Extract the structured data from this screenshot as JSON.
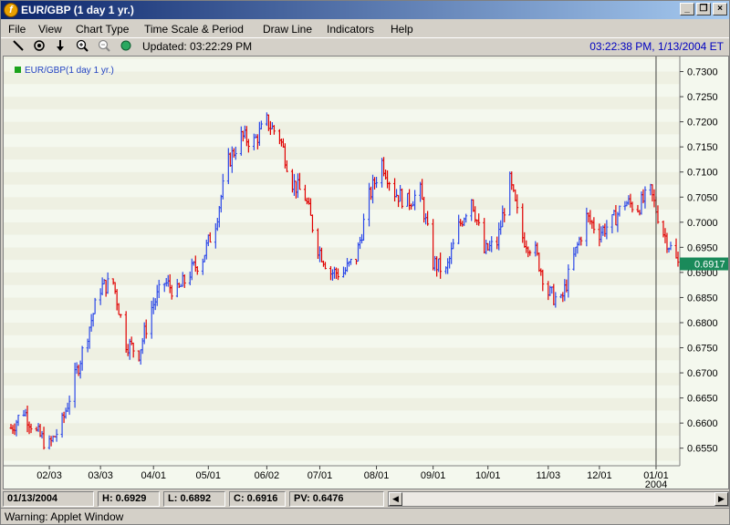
{
  "window": {
    "title": "EUR/GBP (1 day  1 yr.)",
    "minimize": "_",
    "restore": "❐",
    "close": "×"
  },
  "menu": [
    "File",
    "View",
    "Chart Type",
    "Time Scale & Period",
    "Draw Line",
    "Indicators",
    "Help"
  ],
  "toolbar": {
    "updated": "Updated: 03:22:29 PM",
    "clock": "03:22:38 PM, 1/13/2004 ET"
  },
  "status": {
    "date": "01/13/2004",
    "high": "H: 0.6929",
    "low": "L: 0.6892",
    "close": "C: 0.6916",
    "pv": "PV: 0.6476"
  },
  "warning": "Warning: Applet Window",
  "colors": {
    "up": "#2c48e8",
    "down": "#e00000",
    "current": "#1a8a5a",
    "band_a": "#eef0e2",
    "band_b": "#f4f8ee"
  },
  "chart_data": {
    "type": "ohlc",
    "legend": "EUR/GBP(1 day  1 yr.)",
    "ylim": [
      0.6515,
      0.733
    ],
    "y_ticks": [
      "0.7300",
      "0.7250",
      "0.7200",
      "0.7150",
      "0.7100",
      "0.7050",
      "0.7000",
      "0.6950",
      "0.6900",
      "0.6850",
      "0.6800",
      "0.6750",
      "0.6700",
      "0.6650",
      "0.6600",
      "0.6550"
    ],
    "x_ticks": [
      "02/03",
      "03/03",
      "04/01",
      "05/01",
      "06/02",
      "07/01",
      "08/01",
      "09/01",
      "10/01",
      "11/03",
      "12/01",
      "01/01"
    ],
    "x_sublabel": "2004",
    "current_value": "0.6917",
    "grid": false,
    "legend_position": "top-left",
    "close_anchors": [
      [
        "2003-01-13",
        0.659
      ],
      [
        "2003-01-20",
        0.6625
      ],
      [
        "2003-01-27",
        0.658
      ],
      [
        "2003-02-03",
        0.6555
      ],
      [
        "2003-02-10",
        0.66
      ],
      [
        "2003-02-17",
        0.669
      ],
      [
        "2003-02-24",
        0.678
      ],
      [
        "2003-03-03",
        0.687
      ],
      [
        "2003-03-10",
        0.688
      ],
      [
        "2003-03-17",
        0.676
      ],
      [
        "2003-03-24",
        0.674
      ],
      [
        "2003-03-31",
        0.683
      ],
      [
        "2003-04-07",
        0.688
      ],
      [
        "2003-04-14",
        0.686
      ],
      [
        "2003-04-21",
        0.69
      ],
      [
        "2003-04-28",
        0.693
      ],
      [
        "2003-05-05",
        0.7
      ],
      [
        "2003-05-12",
        0.712
      ],
      [
        "2003-05-19",
        0.717
      ],
      [
        "2003-05-26",
        0.716
      ],
      [
        "2003-06-02",
        0.72
      ],
      [
        "2003-06-09",
        0.717
      ],
      [
        "2003-06-16",
        0.708
      ],
      [
        "2003-06-23",
        0.705
      ],
      [
        "2003-06-30",
        0.695
      ],
      [
        "2003-07-07",
        0.69
      ],
      [
        "2003-07-14",
        0.69
      ],
      [
        "2003-07-21",
        0.693
      ],
      [
        "2003-07-28",
        0.705
      ],
      [
        "2003-08-04",
        0.712
      ],
      [
        "2003-08-11",
        0.706
      ],
      [
        "2003-08-18",
        0.704
      ],
      [
        "2003-08-25",
        0.706
      ],
      [
        "2003-09-01",
        0.692
      ],
      [
        "2003-09-08",
        0.69
      ],
      [
        "2003-09-15",
        0.699
      ],
      [
        "2003-09-22",
        0.705
      ],
      [
        "2003-09-29",
        0.694
      ],
      [
        "2003-10-06",
        0.696
      ],
      [
        "2003-10-13",
        0.708
      ],
      [
        "2003-10-20",
        0.697
      ],
      [
        "2003-10-27",
        0.694
      ],
      [
        "2003-11-03",
        0.686
      ],
      [
        "2003-11-10",
        0.684
      ],
      [
        "2003-11-17",
        0.693
      ],
      [
        "2003-11-24",
        0.701
      ],
      [
        "2003-12-01",
        0.698
      ],
      [
        "2003-12-08",
        0.7
      ],
      [
        "2003-12-15",
        0.704
      ],
      [
        "2003-12-22",
        0.703
      ],
      [
        "2003-12-29",
        0.706
      ],
      [
        "2004-01-05",
        0.698
      ],
      [
        "2004-01-13",
        0.6916
      ]
    ]
  }
}
